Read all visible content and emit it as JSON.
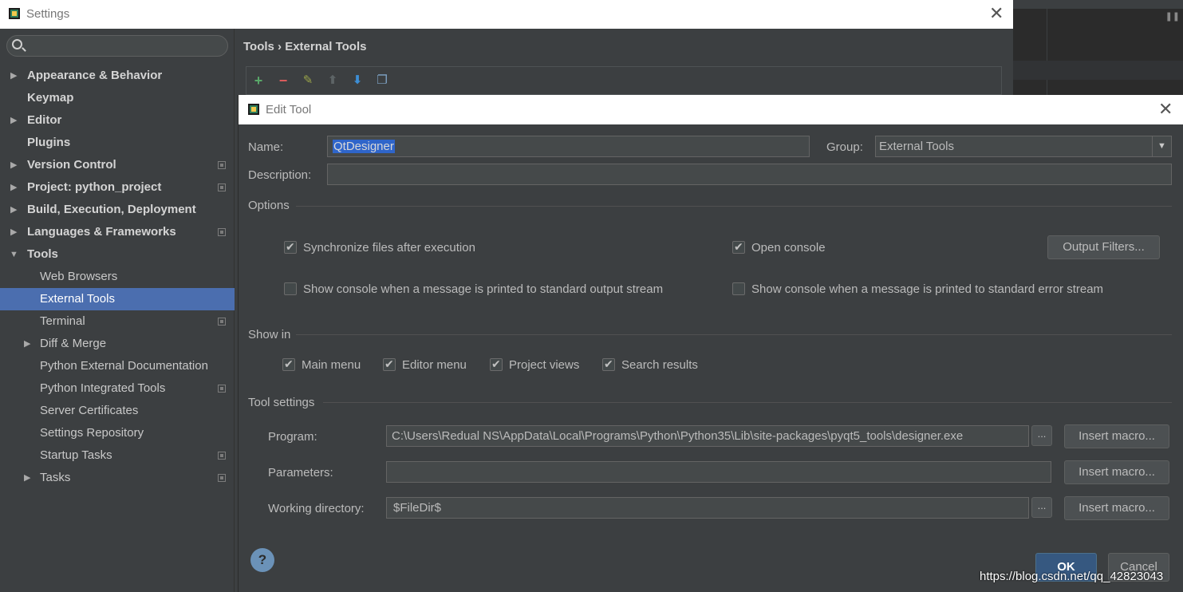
{
  "settings": {
    "title": "Settings",
    "breadcrumb": "Tools › External Tools",
    "sidebar": {
      "items": [
        {
          "label": "Appearance & Behavior",
          "expandable": true
        },
        {
          "label": "Keymap"
        },
        {
          "label": "Editor",
          "expandable": true
        },
        {
          "label": "Plugins"
        },
        {
          "label": "Version Control",
          "expandable": true
        },
        {
          "label": "Project: python_project",
          "expandable": true
        },
        {
          "label": "Build, Execution, Deployment",
          "expandable": true
        },
        {
          "label": "Languages & Frameworks",
          "expandable": true
        },
        {
          "label": "Tools",
          "expanded": true
        },
        {
          "label": "Web Browsers"
        },
        {
          "label": "External Tools",
          "selected": true
        },
        {
          "label": "Terminal"
        },
        {
          "label": "Diff & Merge",
          "expandable": true
        },
        {
          "label": "Python External Documentation"
        },
        {
          "label": "Python Integrated Tools"
        },
        {
          "label": "Server Certificates"
        },
        {
          "label": "Settings Repository"
        },
        {
          "label": "Startup Tasks"
        },
        {
          "label": "Tasks",
          "expandable": true
        }
      ]
    },
    "toolbar_icons": [
      "add-icon",
      "remove-icon",
      "edit-icon",
      "move-up-icon",
      "move-down-icon",
      "copy-icon"
    ]
  },
  "dialog": {
    "title": "Edit Tool",
    "name_label": "Name:",
    "name_value": "QtDesigner",
    "group_label": "Group:",
    "group_value": "External Tools",
    "description_label": "Description:",
    "description_value": "",
    "options_title": "Options",
    "sync_files_label": "Synchronize files after execution",
    "open_console_label": "Open console",
    "output_filters_label": "Output Filters...",
    "show_console_stdout_label": "Show console when a message is printed to standard output stream",
    "show_console_stderr_label": "Show console when a message is printed to standard error stream",
    "show_in_title": "Show in",
    "main_menu_label": "Main menu",
    "editor_menu_label": "Editor menu",
    "project_views_label": "Project views",
    "search_results_label": "Search results",
    "tool_settings_title": "Tool settings",
    "program_label": "Program:",
    "program_value": "C:\\Users\\Redual NS\\AppData\\Local\\Programs\\Python\\Python35\\Lib\\site-packages\\pyqt5_tools\\designer.exe",
    "parameters_label": "Parameters:",
    "parameters_value": "",
    "working_dir_label": "Working directory:",
    "working_dir_value": "$FileDir$",
    "insert_macro_label": "Insert macro...",
    "ellipsis_label": "...",
    "help_label": "?",
    "ok_label": "OK",
    "cancel_label": "Cancel",
    "checkboxes": {
      "sync_files": true,
      "open_console": true,
      "show_console_stdout": false,
      "show_console_stderr": false,
      "main_menu": true,
      "editor_menu": true,
      "project_views": true,
      "search_results": true
    }
  },
  "watermark": "https://blog.csdn.net/qq_42823043",
  "colors": {
    "selection": "#4b6eaf",
    "text_selection": "#2f65ca",
    "ok_button": "#365880",
    "add_icon": "#59a869",
    "remove_icon": "#db5c5c"
  }
}
